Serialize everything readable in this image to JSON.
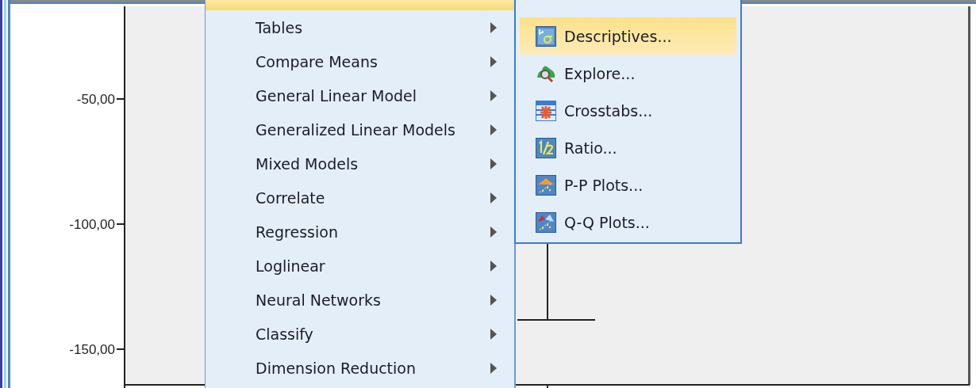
{
  "chart": {
    "y_ticks": [
      "-50,00",
      "-100,00",
      "-150,00"
    ]
  },
  "menu": {
    "parent_item_highlighted": true,
    "items": [
      {
        "label": "Tables",
        "selected": false
      },
      {
        "label": "Compare Means",
        "selected": false
      },
      {
        "label": "General Linear Model",
        "selected": false
      },
      {
        "label": "Generalized Linear Models",
        "selected": false
      },
      {
        "label": "Mixed Models",
        "selected": false
      },
      {
        "label": "Correlate",
        "selected": false
      },
      {
        "label": "Regression",
        "selected": false
      },
      {
        "label": "Loglinear",
        "selected": false
      },
      {
        "label": "Neural Networks",
        "selected": false
      },
      {
        "label": "Classify",
        "selected": false
      },
      {
        "label": "Dimension Reduction",
        "selected": false
      }
    ]
  },
  "submenu": {
    "items": [
      {
        "kind": "descriptives",
        "label": "Descriptives...",
        "selected": true
      },
      {
        "kind": "explore",
        "label": "Explore...",
        "selected": false
      },
      {
        "kind": "crosstabs",
        "label": "Crosstabs...",
        "selected": false
      },
      {
        "kind": "ratio",
        "label": "Ratio...",
        "selected": false
      },
      {
        "kind": "pp",
        "label": "P-P Plots...",
        "selected": false
      },
      {
        "kind": "qq",
        "label": "Q-Q Plots...",
        "selected": false
      }
    ]
  }
}
